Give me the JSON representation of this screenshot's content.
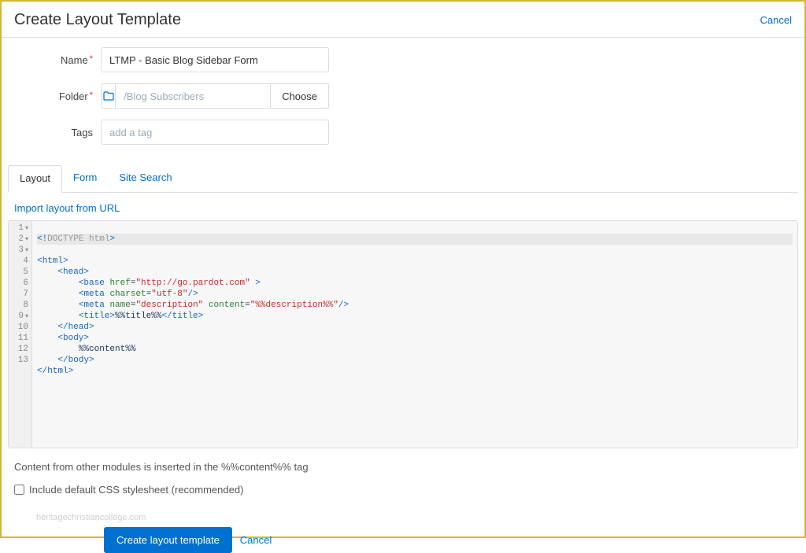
{
  "header": {
    "title": "Create Layout Template",
    "cancel": "Cancel"
  },
  "form": {
    "name_label": "Name",
    "name_value": "LTMP - Basic Blog Sidebar Form",
    "folder_label": "Folder",
    "folder_value": "/Blog Subscribers",
    "choose_label": "Choose",
    "tags_label": "Tags",
    "tags_placeholder": "add a tag"
  },
  "tabs": {
    "layout": "Layout",
    "form": "Form",
    "site_search": "Site Search"
  },
  "import_link": "Import layout from URL",
  "code_lines": [
    "<!DOCTYPE html>",
    "<html>",
    "    <head>",
    "        <base href=\"http://go.pardot.com\" >",
    "        <meta charset=\"utf-8\"/>",
    "        <meta name=\"description\" content=\"%%description%%\"/>",
    "        <title>%%title%%</title>",
    "    </head>",
    "    <body>",
    "        %%content%%",
    "    </body>",
    "</html>",
    ""
  ],
  "note_text": "Content from other modules is inserted in the %%content%% tag",
  "checkbox_label": "Include default CSS stylesheet (recommended)",
  "footer": {
    "create_label": "Create layout template",
    "cancel_label": "Cancel"
  },
  "watermark": "heritagechristiancollege.com"
}
